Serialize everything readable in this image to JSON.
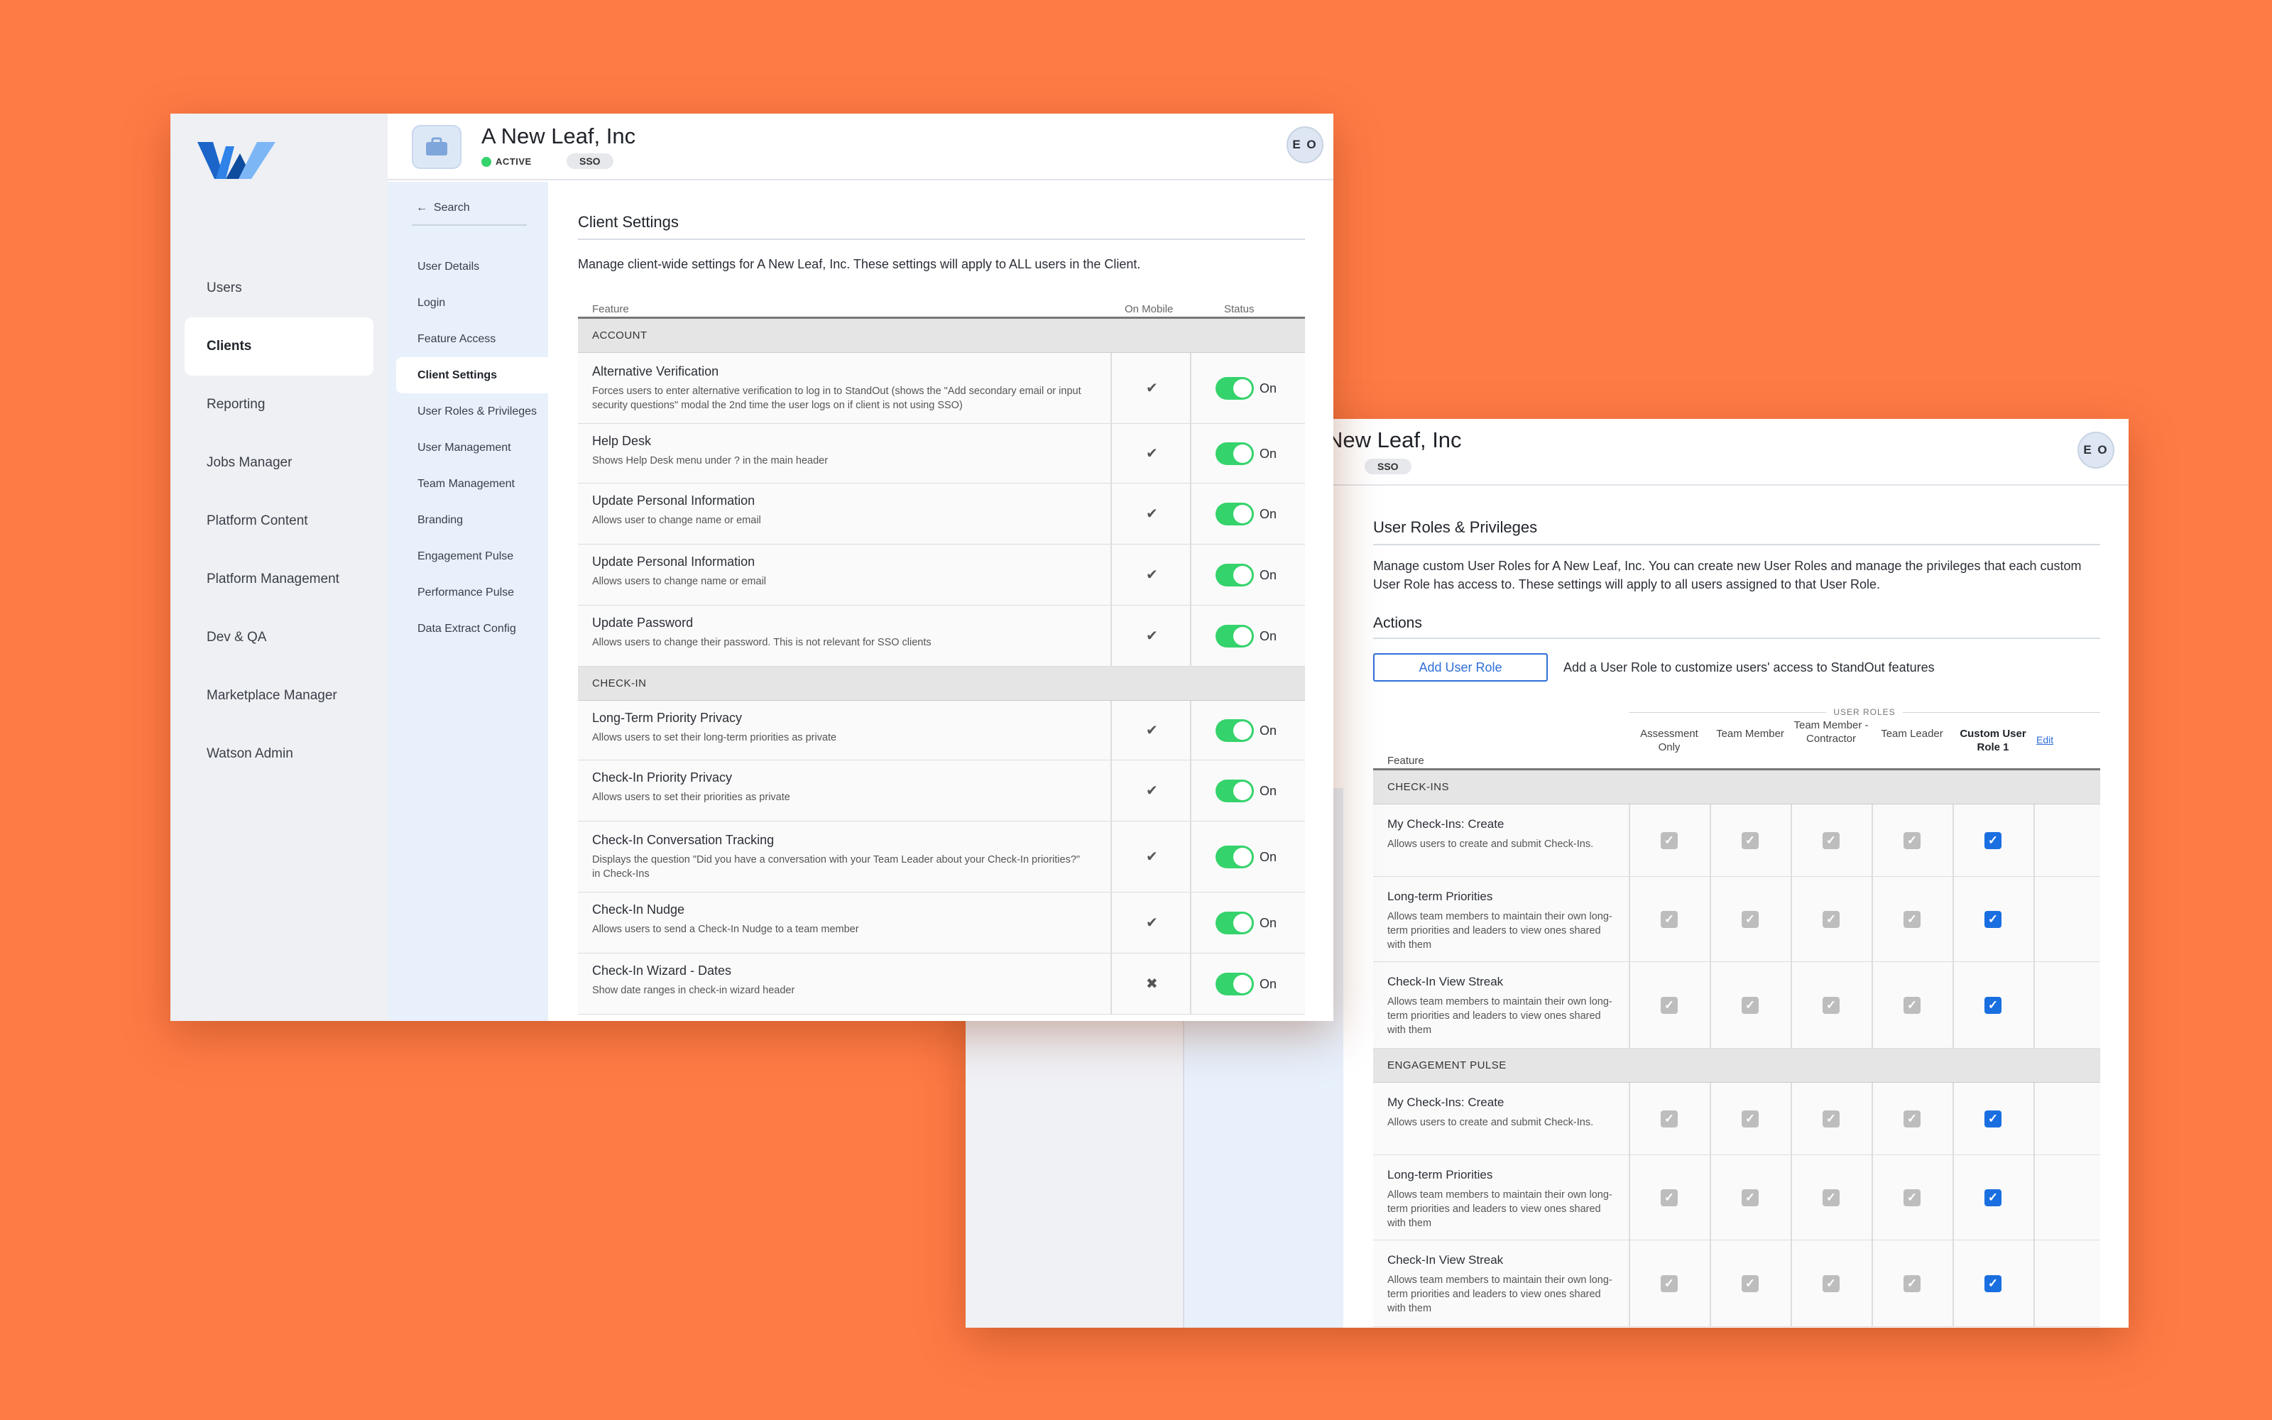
{
  "nav": {
    "items": [
      "Users",
      "Clients",
      "Reporting",
      "Jobs Manager",
      "Platform Content",
      "Platform Management",
      "Dev & QA",
      "Marketplace Manager",
      "Watson Admin"
    ],
    "active": "Clients"
  },
  "client": {
    "name": "A New Leaf, Inc",
    "status": "ACTIVE",
    "auth": "SSO",
    "user_initials": "E O"
  },
  "subnav": {
    "back_label": "Search",
    "items": [
      "User Details",
      "Login",
      "Feature Access",
      "Client Settings",
      "User Roles & Privileges",
      "User Management",
      "Team Management",
      "Branding",
      "Engagement Pulse",
      "Performance Pulse",
      "Data Extract Config"
    ],
    "active": "Client Settings"
  },
  "client_settings": {
    "title": "Client Settings",
    "description": "Manage client-wide settings for A New Leaf, Inc. These settings will apply to ALL users in the Client.",
    "columns": {
      "feature": "Feature",
      "mobile": "On Mobile",
      "status": "Status"
    },
    "on_label": "On",
    "sections": [
      {
        "name": "ACCOUNT",
        "rows": [
          {
            "title": "Alternative Verification",
            "desc": "Forces users to enter alternative verification to log in to StandOut (shows the \"Add secondary email or input security questions\" modal the 2nd time the user logs on if client is not using SSO)",
            "mobile": "check",
            "status": "On"
          },
          {
            "title": "Help Desk",
            "desc": "Shows Help Desk menu under ? in the main header",
            "mobile": "check",
            "status": "On"
          },
          {
            "title": "Update Personal Information",
            "desc": "Allows user to change name or email",
            "mobile": "check",
            "status": "On"
          },
          {
            "title": "Update Personal Information",
            "desc": "Allows users to change name or email",
            "mobile": "check",
            "status": "On"
          },
          {
            "title": "Update Password",
            "desc": "Allows users to change their password. This is not relevant for SSO clients",
            "mobile": "check",
            "status": "On"
          }
        ]
      },
      {
        "name": "CHECK-IN",
        "rows": [
          {
            "title": "Long-Term Priority Privacy",
            "desc": "Allows users to set their long-term priorities as private",
            "mobile": "check",
            "status": "On"
          },
          {
            "title": "Check-In Priority Privacy",
            "desc": "Allows users to set their priorities as private",
            "mobile": "check",
            "status": "On"
          },
          {
            "title": "Check-In Conversation Tracking",
            "desc": "Displays the question \"Did you have a conversation with your Team Leader about your Check-In priorities?\" in Check-Ins",
            "mobile": "check",
            "status": "On"
          },
          {
            "title": "Check-In Nudge",
            "desc": "Allows users to send a Check-In Nudge to a team member",
            "mobile": "check",
            "status": "On"
          },
          {
            "title": "Check-In Wizard - Dates",
            "desc": "Show date ranges in check-in wizard header",
            "mobile": "cross",
            "status": "On"
          }
        ]
      }
    ]
  },
  "user_roles": {
    "title": "User Roles & Privileges",
    "description": "Manage custom User Roles for A New Leaf, Inc. You can create new User Roles and manage the privileges that each custom User Role has access to. These settings will apply to all users assigned to that User Role.",
    "actions_title": "Actions",
    "add_button": "Add User Role",
    "add_hint": "Add a User Role to customize users' access to StandOut features",
    "roles_label": "USER ROLES",
    "feature_label": "Feature",
    "roles": [
      "Assessment Only",
      "Team Member",
      "Team Member - Contractor",
      "Team Leader",
      "Custom User Role 1"
    ],
    "edit_label": "Edit",
    "sections": [
      {
        "name": "CHECK-INS",
        "rows": [
          {
            "title": "My Check-Ins: Create",
            "desc": "Allows users to create and submit Check-Ins."
          },
          {
            "title": "Long-term Priorities",
            "desc": "Allows team members to maintain their own long-term priorities and leaders to view ones shared with them"
          },
          {
            "title": "Check-In View Streak",
            "desc": "Allows team members to maintain their own long-term priorities and leaders to view ones shared with them"
          }
        ]
      },
      {
        "name": "ENGAGEMENT PULSE",
        "rows": [
          {
            "title": "My Check-Ins: Create",
            "desc": "Allows users to create and submit Check-Ins."
          },
          {
            "title": "Long-term Priorities",
            "desc": "Allows team members to maintain their own long-term priorities and leaders to view ones shared with them"
          },
          {
            "title": "Check-In View Streak",
            "desc": "Allows team members to maintain their own long-term priorities and leaders to view ones shared with them"
          }
        ]
      }
    ]
  },
  "colors": {
    "background": "#FF7B45",
    "toggle_on": "#35D36B",
    "accent_blue": "#1A6FE0",
    "active_dot": "#35D36B"
  }
}
